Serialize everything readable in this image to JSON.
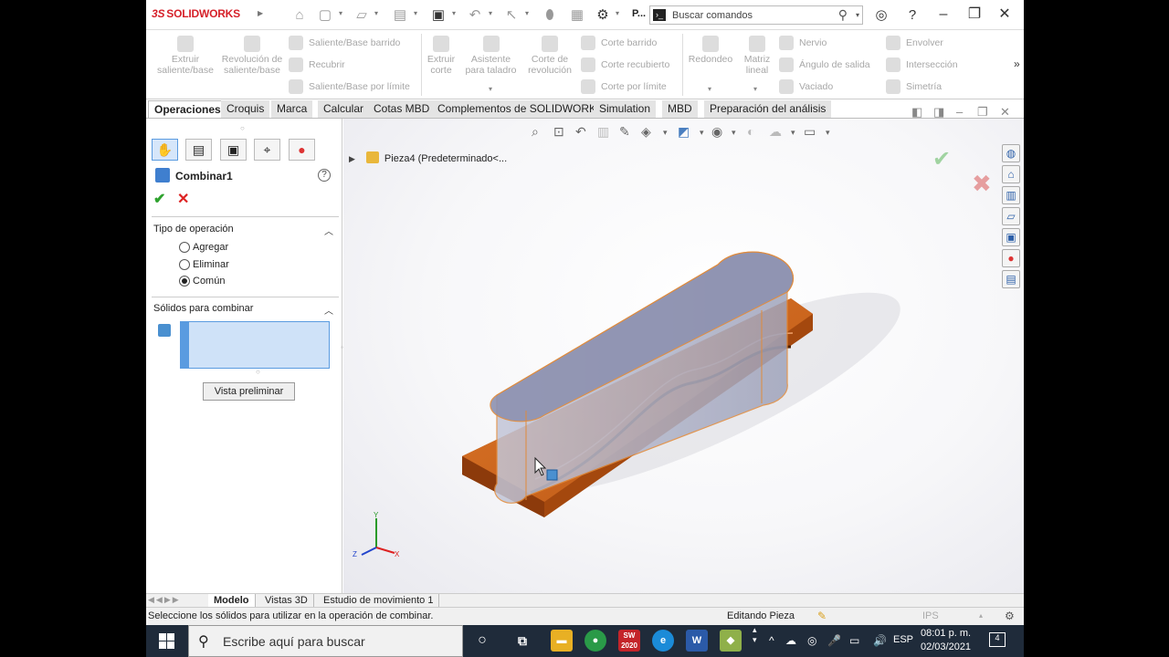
{
  "app": {
    "logo_prefix": "3S",
    "logo_text": "SOLIDWORKS",
    "pin_label": "P...",
    "search_placeholder": "Buscar comandos"
  },
  "command_manager": {
    "extrude_boss": "Extruir saliente/base",
    "revolve_boss": "Revolución de saliente/base",
    "swept_boss": "Saliente/Base barrido",
    "loft_boss": "Recubrir",
    "boundary_boss": "Saliente/Base por límite",
    "extrude_cut": "Extruir corte",
    "hole_wizard": "Asistente para taladro",
    "revolve_cut": "Corte de revolución",
    "swept_cut": "Corte barrido",
    "loft_cut": "Corte recubierto",
    "boundary_cut": "Corte por límite",
    "fillet": "Redondeo",
    "linear_pattern": "Matriz lineal",
    "rib": "Nervio",
    "draft": "Ángulo de salida",
    "shell": "Vaciado",
    "wrap": "Envolver",
    "intersect": "Intersección",
    "mirror": "Simetría"
  },
  "tabs": [
    "Operaciones",
    "Croquis",
    "Marca",
    "Calcular",
    "Cotas MBD",
    "Complementos de SOLIDWORKS",
    "Simulation",
    "MBD",
    "Preparación del análisis"
  ],
  "property_manager": {
    "title": "Combinar1",
    "help": "?",
    "section_operation": "Tipo de operación",
    "options": [
      "Agregar",
      "Eliminar",
      "Común"
    ],
    "selected_option": "Común",
    "section_bodies": "Sólidos para combinar",
    "preview_button": "Vista preliminar"
  },
  "viewport": {
    "tree_root": "Pieza4  (Predeterminado<..."
  },
  "bottom_tabs": [
    "Modelo",
    "Vistas 3D",
    "Estudio de movimiento 1"
  ],
  "status": {
    "message": "Seleccione los sólidos para utilizar en la operación de combinar.",
    "mode": "Editando Pieza",
    "units": "IPS"
  },
  "taskbar": {
    "search_text": "Escribe aquí para buscar",
    "language": "ESP",
    "time": "08:01 p. m.",
    "date": "02/03/2021",
    "notification_count": "4",
    "sw_badge": "SW 2020"
  },
  "colors": {
    "brand": "#d6212a",
    "part_orange": "#c8631a",
    "combine_body": "#a5a9c4",
    "taskbar": "#1f2b3a"
  }
}
